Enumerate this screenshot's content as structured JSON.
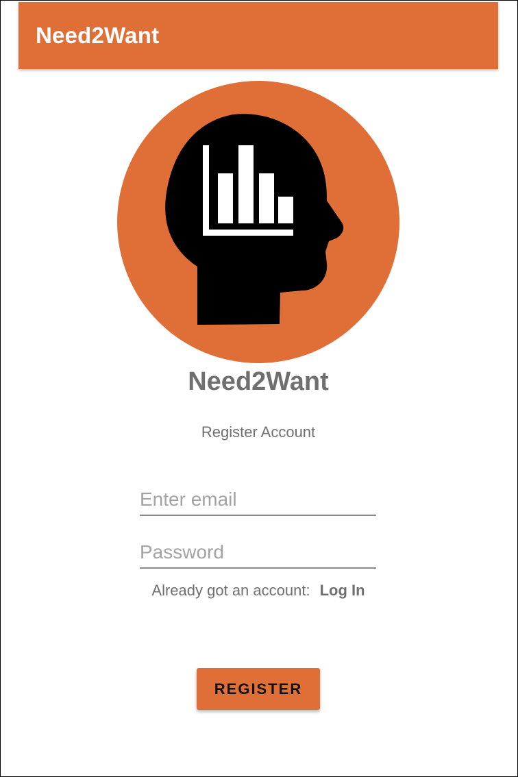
{
  "appbar": {
    "title": "Need2Want"
  },
  "branding": {
    "app_name": "Need2Want",
    "logo_icon": "head-with-bar-chart-icon"
  },
  "screen": {
    "subtitle": "Register Account"
  },
  "form": {
    "email": {
      "placeholder": "Enter email",
      "value": ""
    },
    "password": {
      "placeholder": "Password",
      "value": ""
    }
  },
  "account_prompt": {
    "text": "Already got an account:",
    "link_label": "Log In"
  },
  "actions": {
    "register_label": "REGISTER"
  },
  "colors": {
    "accent": "#e06e37",
    "text_muted": "#6f6f6f",
    "placeholder": "#a3a3a3",
    "logo_silhouette": "#000000"
  }
}
